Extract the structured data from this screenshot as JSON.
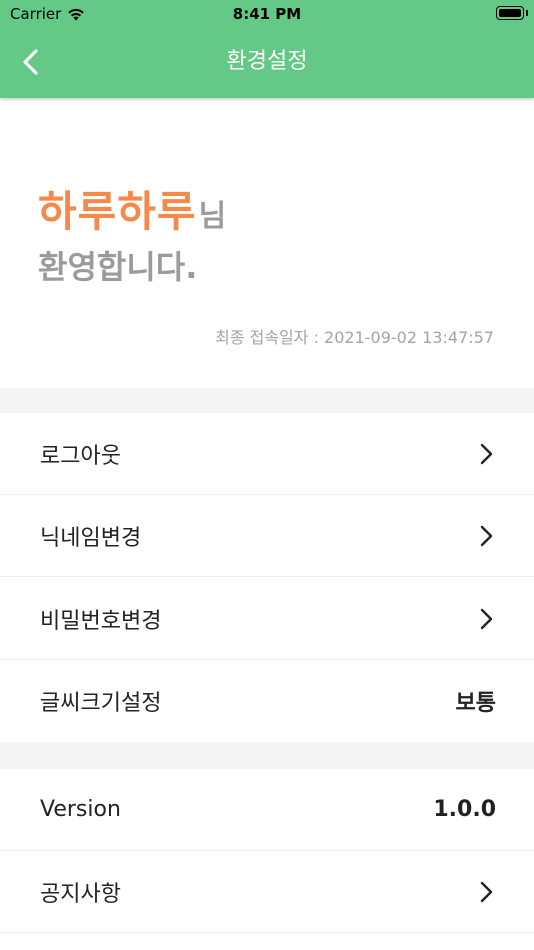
{
  "status_bar": {
    "carrier": "Carrier",
    "time": "8:41 PM"
  },
  "header": {
    "title": "환경설정",
    "back_icon": "chevron-left-icon"
  },
  "welcome": {
    "username": "하루하루",
    "honorific": "님",
    "greeting": "환영합니다.",
    "last_login": "최종 접속일자 : 2021-09-02 13:47:57"
  },
  "settings": {
    "logout": "로그아웃",
    "change_nickname": "닉네임변경",
    "change_password": "비밀번호변경",
    "font_size_label": "글씨크기설정",
    "font_size_value": "보통"
  },
  "info": {
    "version_label": "Version",
    "version_value": "1.0.0",
    "notice": "공지사항"
  },
  "colors": {
    "header_bg": "#64c886",
    "accent": "#f5894a",
    "muted": "#9b9b9b",
    "section_gap": "#f4f4f4"
  }
}
